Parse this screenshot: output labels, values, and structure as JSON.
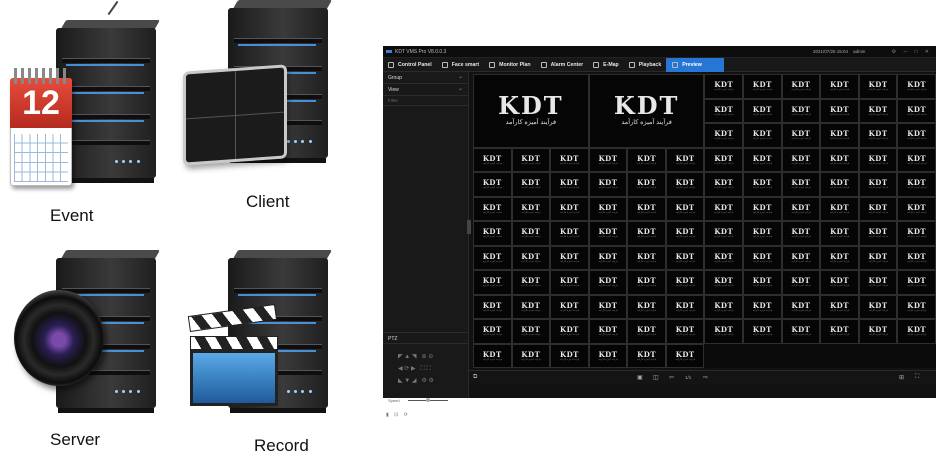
{
  "illustration": {
    "labels": {
      "event": "Event",
      "client": "Client",
      "server": "Server",
      "record": "Record"
    },
    "calendar_day": "12"
  },
  "vms": {
    "title": "KDT VMS Pro V8.0.0.3",
    "status": {
      "datetime": "2021/07/26 15:04",
      "user": "admin"
    },
    "tabs": [
      {
        "label": "Control Panel",
        "icon": "control-panel-icon"
      },
      {
        "label": "Face smart",
        "icon": "face-smart-icon"
      },
      {
        "label": "Monitor Plan",
        "icon": "monitor-plan-icon"
      },
      {
        "label": "Alarm Center",
        "icon": "alarm-center-icon"
      },
      {
        "label": "E-Map",
        "icon": "e-map-icon"
      },
      {
        "label": "Playback",
        "icon": "playback-icon"
      },
      {
        "label": "Preview",
        "icon": "preview-icon",
        "active": true
      }
    ],
    "sidebar": {
      "group_label": "Group",
      "view_label": "View",
      "filter_placeholder": "Filter",
      "ptz_label": "PTZ",
      "speed_label": "Speed"
    },
    "tile": {
      "logo": "KDT",
      "subtitle": "فرآیند آمیزه کارآمد"
    },
    "layout": {
      "large_tiles": 2,
      "small_tiles": 120
    },
    "bottombar": {
      "page": "1/1"
    },
    "colors": {
      "accent": "#2676d6",
      "background": "#121212",
      "grid_border": "#2d2d2d"
    }
  }
}
